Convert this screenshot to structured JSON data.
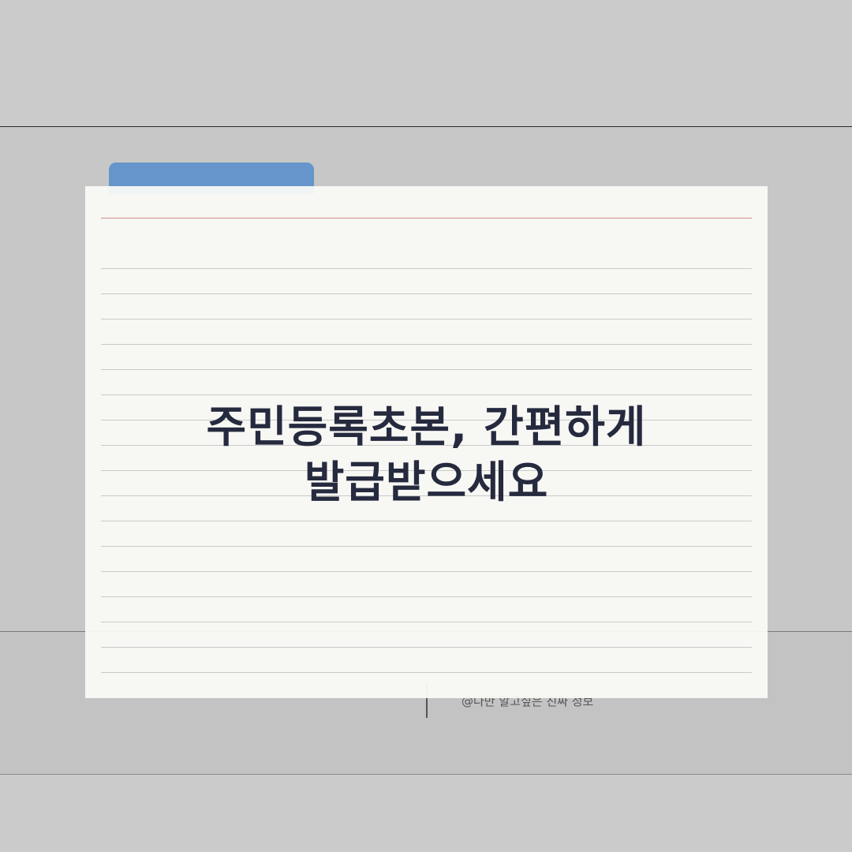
{
  "headline": {
    "line1": "주민등록초본, 간편하게",
    "line2": "발급받으세요"
  },
  "footer": {
    "credit": "@나만 알고싶은 진짜 정보"
  },
  "colors": {
    "tab": "#6595cb",
    "card": "#fafaf6",
    "margin_line": "#d88a86",
    "text": "#262a3e",
    "background": "#cbcbcb"
  }
}
